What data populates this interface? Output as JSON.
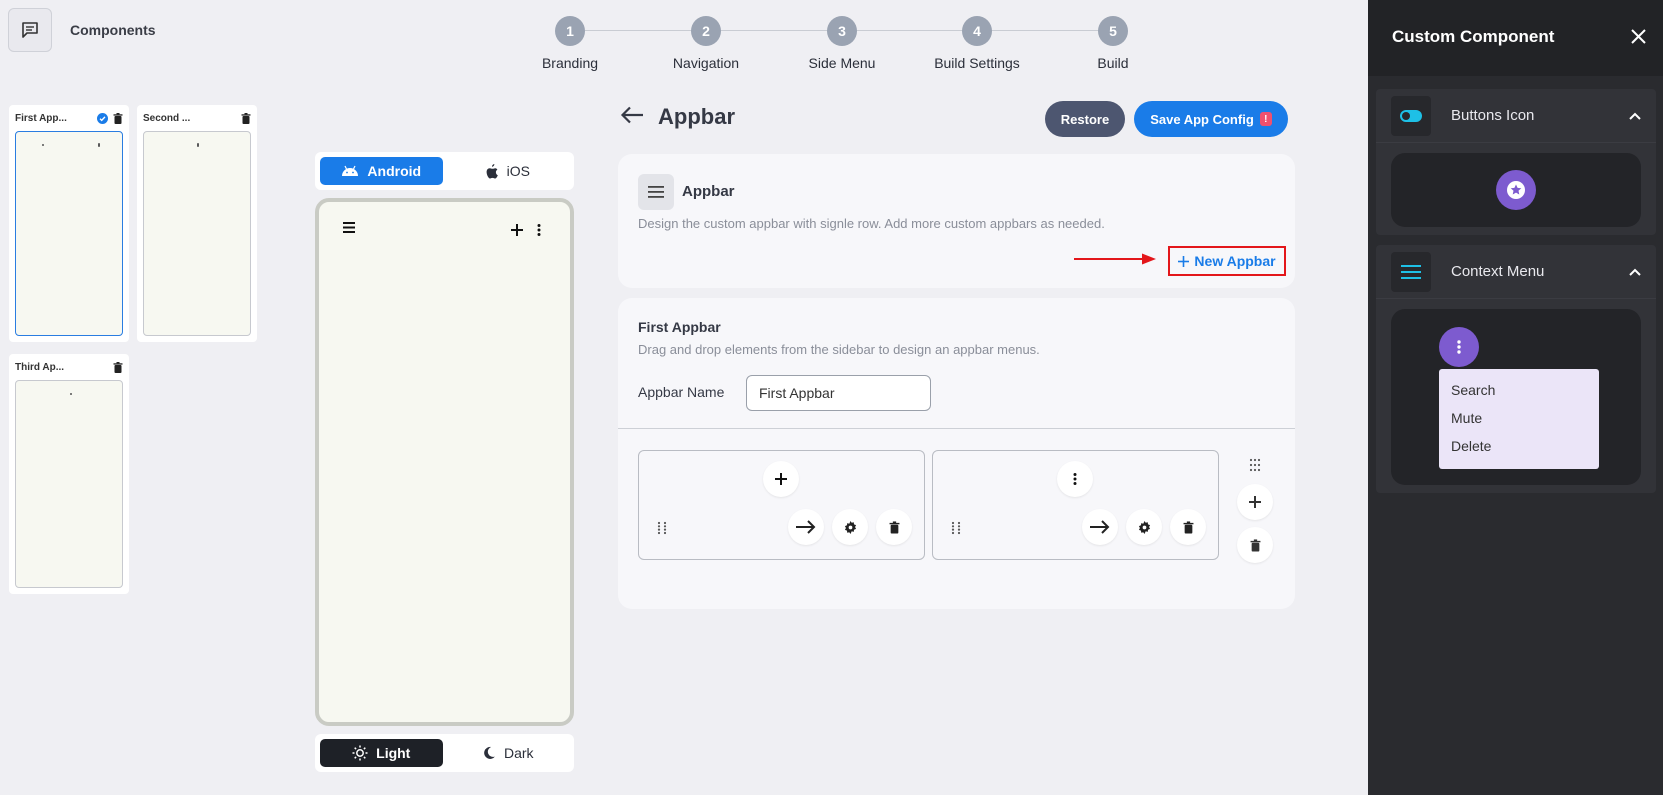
{
  "header": {
    "components_label": "Components",
    "chat_icon": "chat-icon"
  },
  "stepper": [
    {
      "num": "1",
      "label": "Branding"
    },
    {
      "num": "2",
      "label": "Navigation"
    },
    {
      "num": "3",
      "label": "Side Menu"
    },
    {
      "num": "4",
      "label": "Build Settings"
    },
    {
      "num": "5",
      "label": "Build"
    }
  ],
  "thumbnails": [
    {
      "name": "First App...",
      "selected": true
    },
    {
      "name": "Second ...",
      "selected": false
    },
    {
      "name": "Third Ap...",
      "selected": false
    }
  ],
  "platform": {
    "android": "Android",
    "ios": "iOS",
    "selected": "Android"
  },
  "theme": {
    "light": "Light",
    "dark": "Dark",
    "selected": "Light"
  },
  "page": {
    "title": "Appbar",
    "restore_label": "Restore",
    "save_label": "Save App Config",
    "save_badge": "!"
  },
  "appbar_card": {
    "title": "Appbar",
    "description": "Design the custom appbar with signle row. Add more custom appbars as needed.",
    "new_button": "New Appbar"
  },
  "editor_card": {
    "title": "First Appbar",
    "description": "Drag and drop elements from the sidebar to design an appbar menus.",
    "name_label": "Appbar Name",
    "name_value": "First Appbar"
  },
  "panel": {
    "title": "Custom Component",
    "sections": [
      {
        "label": "Buttons Icon"
      },
      {
        "label": "Context Menu",
        "menu_items": [
          "Search",
          "Mute",
          "Delete"
        ]
      }
    ]
  },
  "colors": {
    "primary": "#1a7ce8",
    "restore": "#4d5670",
    "panel_bg": "#2a2b2f",
    "accent_purple": "#7d5bcf",
    "highlight_red": "#e3161a"
  }
}
